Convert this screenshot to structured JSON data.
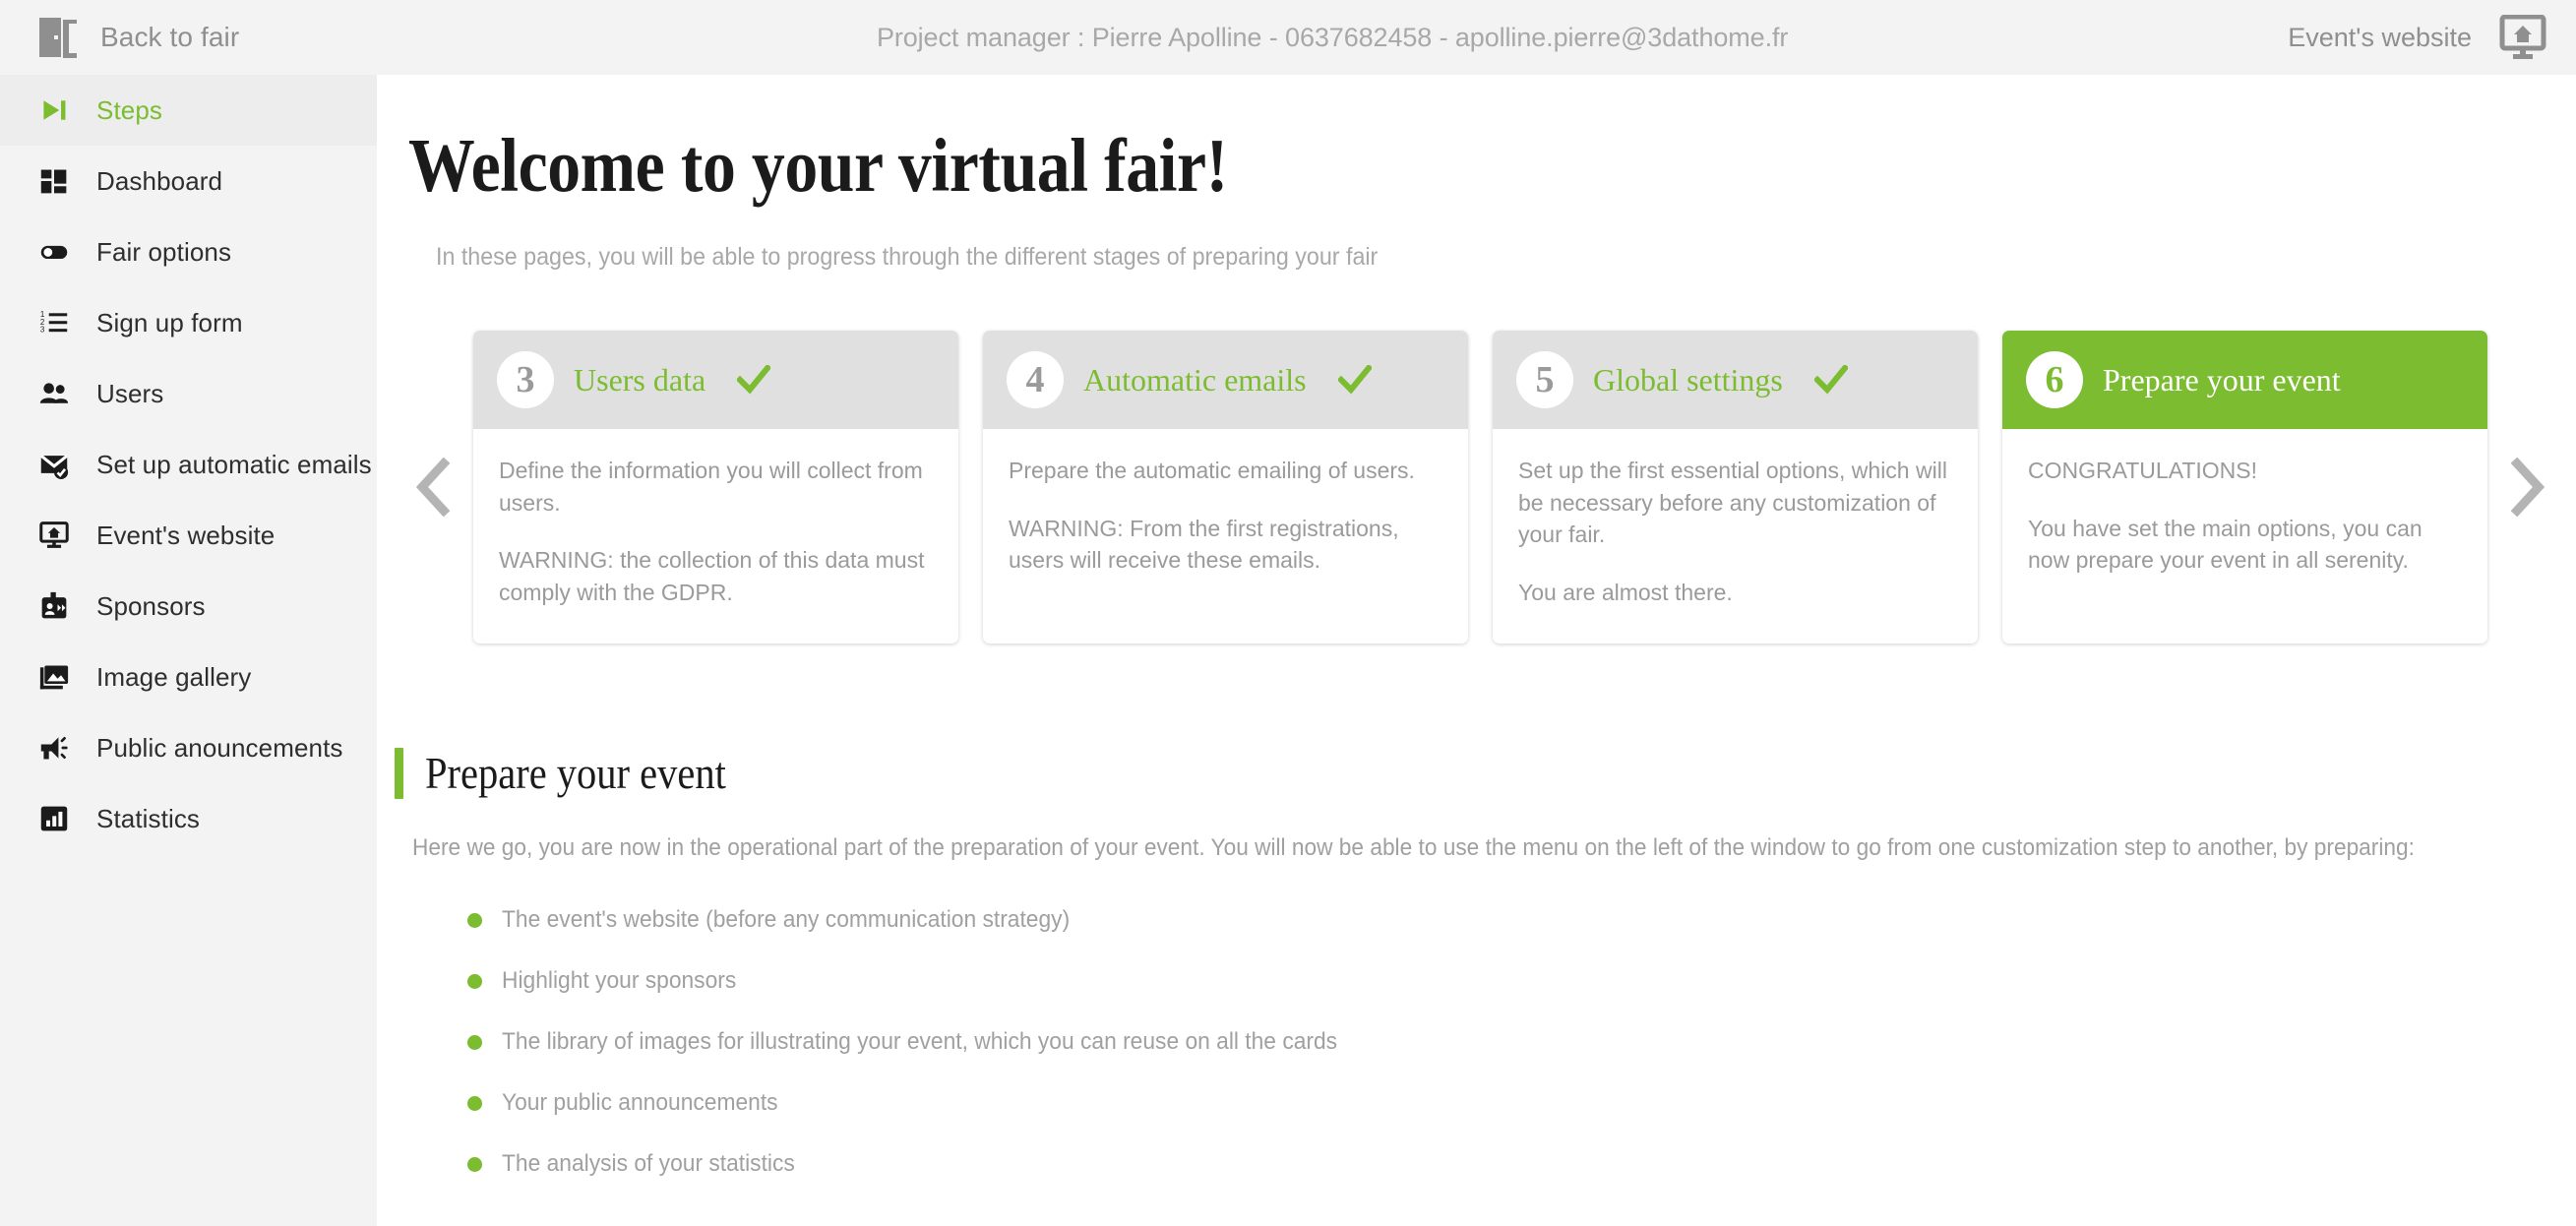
{
  "topbar": {
    "back_label": "Back to fair",
    "back_icon": "door-exit-icon",
    "project_manager": "Project manager : Pierre Apolline - 0637682458 - apolline.pierre@3dathome.fr",
    "event_website_label": "Event's website",
    "event_website_icon": "monitor-home-icon"
  },
  "sidebar": {
    "items": [
      {
        "label": "Steps",
        "icon": "skip-forward-icon",
        "active": true
      },
      {
        "label": "Dashboard",
        "icon": "dashboard-grid-icon",
        "active": false
      },
      {
        "label": "Fair options",
        "icon": "toggle-switch-icon",
        "active": false
      },
      {
        "label": "Sign up form",
        "icon": "numbered-list-icon",
        "active": false
      },
      {
        "label": "Users",
        "icon": "users-icon",
        "active": false
      },
      {
        "label": "Set up automatic emails",
        "icon": "envelope-check-icon",
        "active": false
      },
      {
        "label": "Event's website",
        "icon": "monitor-home-icon",
        "active": false
      },
      {
        "label": "Sponsors",
        "icon": "badge-id-icon",
        "active": false
      },
      {
        "label": "Image gallery",
        "icon": "image-folder-icon",
        "active": false
      },
      {
        "label": "Public anouncements",
        "icon": "megaphone-icon",
        "active": false
      },
      {
        "label": "Statistics",
        "icon": "bar-chart-icon",
        "active": false
      }
    ]
  },
  "main": {
    "title": "Welcome to your virtual fair!",
    "subtitle": "In these pages, you will be able to progress through the different stages of preparing your fair",
    "carousel": {
      "prev_icon": "chevron-left-icon",
      "next_icon": "chevron-right-icon",
      "cards": [
        {
          "number": "3",
          "title": "Users data",
          "done": true,
          "check_icon": "check-icon",
          "active": false,
          "paragraphs": [
            "Define the information you will collect from users.",
            "WARNING: the collection of this data must comply with the GDPR."
          ]
        },
        {
          "number": "4",
          "title": "Automatic emails",
          "done": true,
          "check_icon": "check-icon",
          "active": false,
          "paragraphs": [
            "Prepare the automatic emailing of users.",
            "WARNING: From the first registrations, users will receive these emails."
          ]
        },
        {
          "number": "5",
          "title": "Global settings",
          "done": true,
          "check_icon": "check-icon",
          "active": false,
          "paragraphs": [
            "Set up the first essential options, which will be necessary before any customization of your fair.",
            "You are almost there."
          ]
        },
        {
          "number": "6",
          "title": "Prepare your event",
          "done": false,
          "check_icon": "",
          "active": true,
          "paragraphs": [
            "CONGRATULATIONS!",
            "You have set the main options, you can now prepare your event in all serenity."
          ]
        }
      ]
    },
    "section": {
      "title": "Prepare your event",
      "intro": "Here we go, you are now in the operational part of the preparation of your event. You will now be able to use the menu on the left of the window to go from one customization step to another, by preparing:",
      "bullets": [
        "The event's website (before any communication strategy)",
        "Highlight your sponsors",
        "The library of images for illustrating your event, which you can reuse on all the cards",
        "Your public announcements",
        "The analysis of your statistics"
      ]
    }
  },
  "colors": {
    "accent_green": "#7cbc31",
    "sidebar_bg": "#f3f3f3",
    "card_head_gray": "#e0e0e0",
    "text_gray": "#a0a0a0"
  }
}
